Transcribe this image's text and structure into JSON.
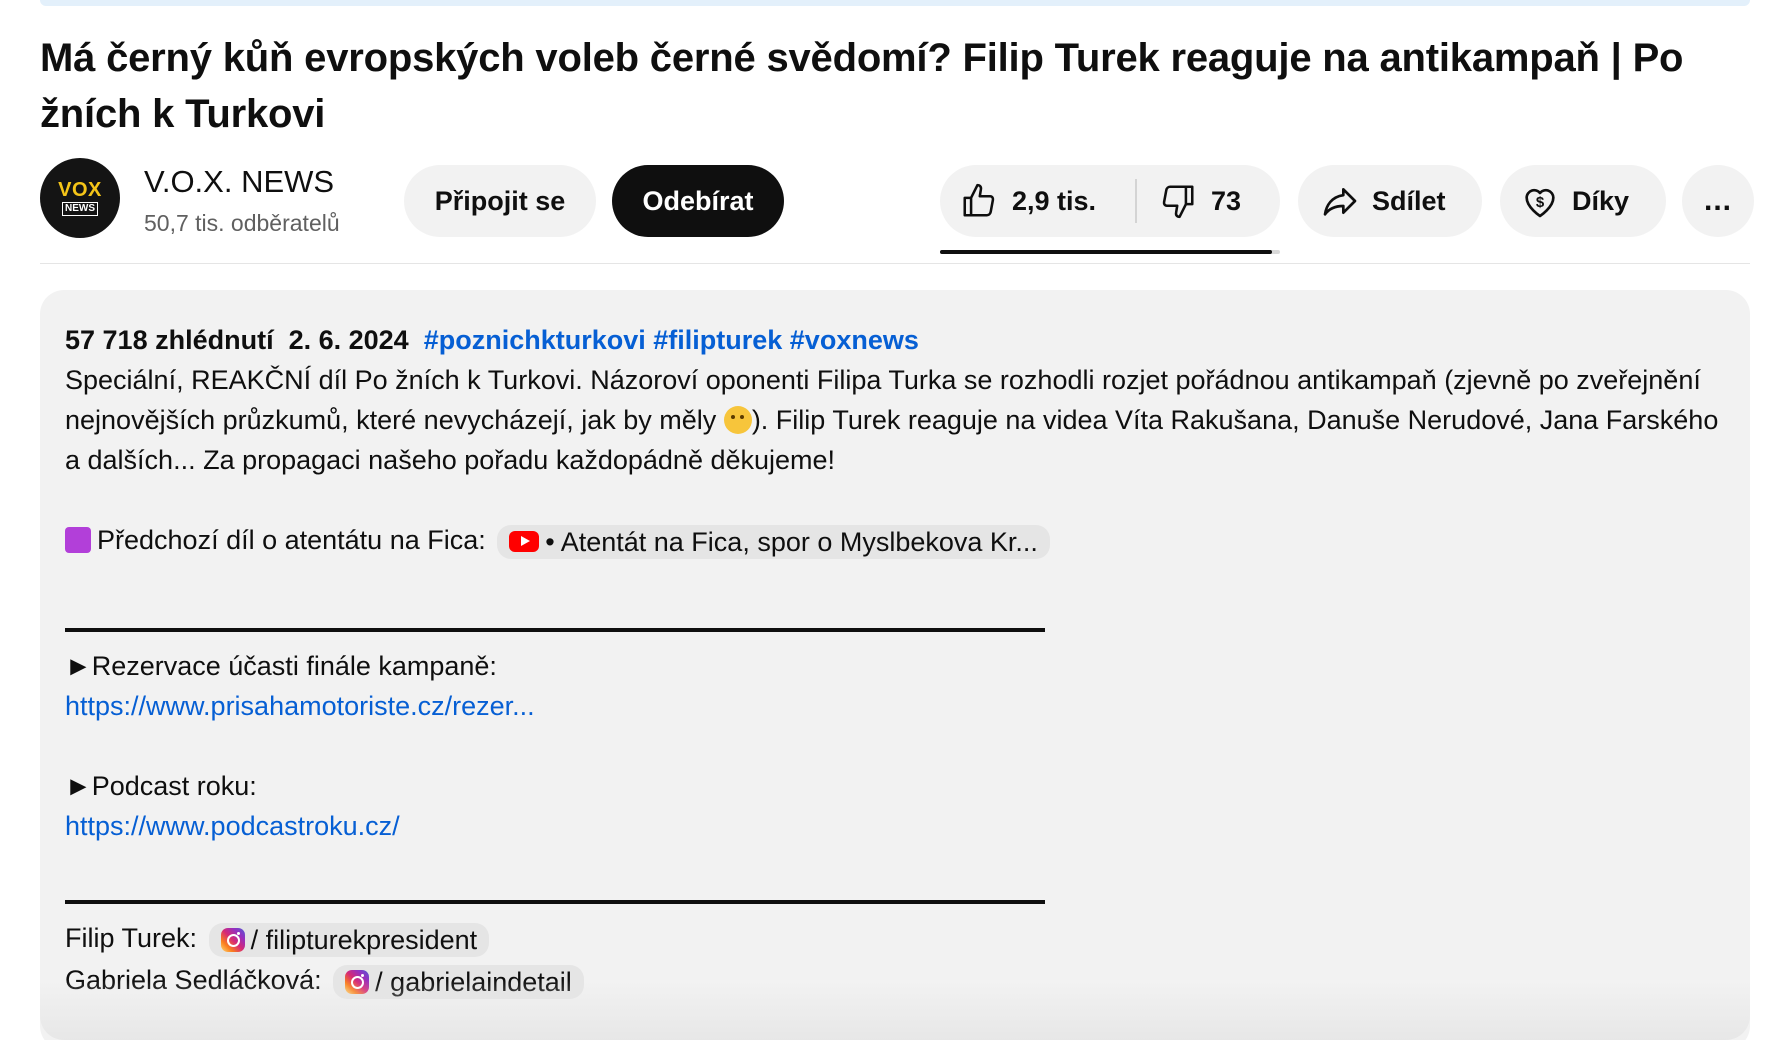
{
  "video": {
    "title": "Má černý kůň evropských voleb černé svědomí? Filip Turek reaguje na antikampaň | Po žních k Turkovi"
  },
  "channel": {
    "avatar_text_top": "VOX",
    "avatar_text_bottom": "NEWS",
    "name": "V.O.X. NEWS",
    "subscribers": "50,7 tis. odběratelů",
    "join_label": "Připojit se",
    "subscribe_label": "Odebírat"
  },
  "actions": {
    "likes": "2,9 tis.",
    "dislikes": "73",
    "like_ratio": 0.975,
    "share_label": "Sdílet",
    "thanks_label": "Díky",
    "more_label": "..."
  },
  "description": {
    "views": "57 718 zhlédnutí",
    "date": "2. 6. 2024",
    "hashtags": "#poznichkturkovi #filipturek #voxnews",
    "intro_1": "Speciální, REAKČNÍ díl Po žních k Turkovi. Názoroví oponenti Filipa Turka se rozhodli rozjet pořádnou antikampaň (zjevně po zveřejnění nejnovějších průzkumů, které nevycházejí, jak by měly ",
    "intro_2": "). Filip Turek reaguje na videa Víta Rakušana, Danuše Nerudové, Jana Farského a dalších... Za propagaci našeho pořadu každopádně děkujeme!",
    "previous_label": "Předchozí díl o atentátu na Fica:",
    "previous_chip": "• Atentát na Fica, spor o Myslbekova Kr...",
    "reservation_label": "►Rezervace účasti finále kampaně:",
    "reservation_link": "https://www.prisahamotoriste.cz/rezer...",
    "podcast_label": "►Podcast roku:",
    "podcast_link": "https://www.podcastroku.cz/",
    "social": [
      {
        "person": "Filip Turek:",
        "handle": "/ filipturekpresident"
      },
      {
        "person": "Gabriela Sedláčková:",
        "handle": "/ gabrielaindetail"
      }
    ]
  },
  "colors": {
    "link": "#065fd4",
    "subscribe_bg": "#0f0f0f",
    "pill_bg": "#f2f2f2"
  }
}
